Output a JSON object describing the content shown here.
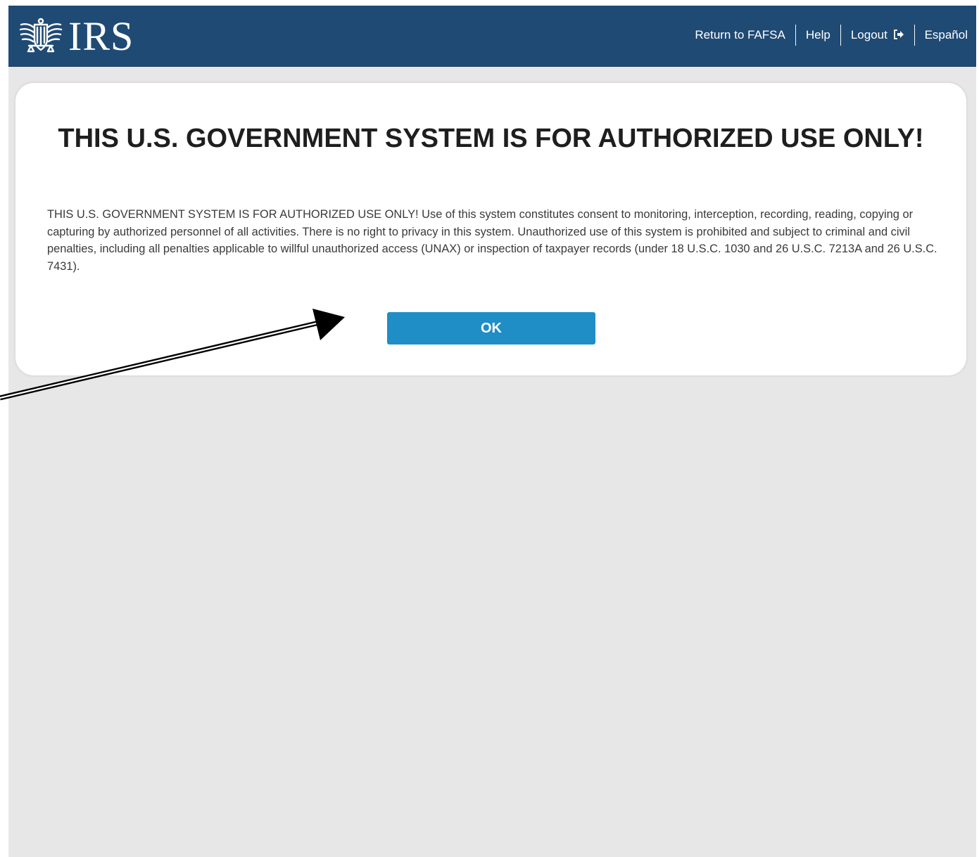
{
  "header": {
    "logo_text": "IRS",
    "nav": [
      {
        "label": "Return to FAFSA"
      },
      {
        "label": "Help"
      },
      {
        "label": "Logout"
      },
      {
        "label": "Español"
      }
    ]
  },
  "notice": {
    "title": "THIS U.S. GOVERNMENT SYSTEM IS FOR AUTHORIZED USE ONLY!",
    "body": "THIS U.S. GOVERNMENT SYSTEM IS FOR AUTHORIZED USE ONLY! Use of this system constitutes consent to monitoring, interception, recording, reading, copying or capturing by authorized personnel of all activities. There is no right to privacy in this system. Unauthorized use of this system is prohibited and subject to criminal and civil penalties, including all penalties applicable to willful unauthorized access (UNAX) or inspection of taxpayer records (under 18 U.S.C. 1030 and 26 U.S.C. 7213A and 26 U.S.C. 7431).",
    "ok_label": "OK"
  },
  "colors": {
    "header_bg": "#1f4a74",
    "page_bg": "#e7e7e7",
    "button_bg": "#1f8dc6"
  },
  "icons": {
    "logo": "irs-eagle-icon",
    "logout": "logout-icon",
    "annotation": "arrow-pointer"
  }
}
